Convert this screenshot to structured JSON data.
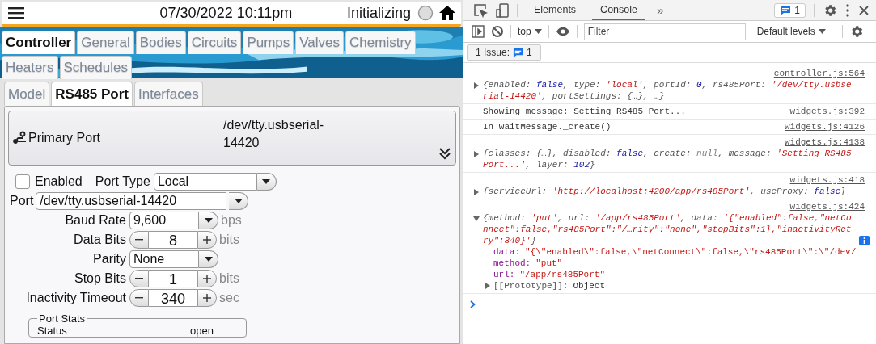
{
  "app": {
    "datetime": "07/30/2022 10:11pm",
    "status": "Initializing",
    "tabs": [
      {
        "label": "Controller",
        "selected": true
      },
      {
        "label": "General",
        "selected": false
      },
      {
        "label": "Bodies",
        "selected": false
      },
      {
        "label": "Circuits",
        "selected": false
      },
      {
        "label": "Pumps",
        "selected": false
      },
      {
        "label": "Valves",
        "selected": false
      },
      {
        "label": "Chemistry",
        "selected": false
      },
      {
        "label": "Heaters",
        "selected": false
      },
      {
        "label": "Schedules",
        "selected": false
      }
    ],
    "subtabs": [
      {
        "label": "Model",
        "selected": false
      },
      {
        "label": "RS485 Port",
        "selected": true
      },
      {
        "label": "Interfaces",
        "selected": false
      }
    ],
    "port_panel": {
      "title": "Primary Port",
      "value": "/dev/tty.usbserial-14420",
      "expanded": false
    },
    "enabled": {
      "label": "Enabled",
      "checked": false
    },
    "port_type": {
      "label": "Port Type",
      "value": "Local"
    },
    "port": {
      "label": "Port",
      "value": "/dev/tty.usbserial-14420"
    },
    "settings": [
      {
        "kind": "select",
        "label": "Baud Rate",
        "value": "9,600",
        "unit": "bps"
      },
      {
        "kind": "stepper",
        "label": "Data Bits",
        "value": "8",
        "unit": "bits"
      },
      {
        "kind": "select",
        "label": "Parity",
        "value": "None"
      },
      {
        "kind": "stepper",
        "label": "Stop Bits",
        "value": "1",
        "unit": "bits"
      },
      {
        "kind": "stepper",
        "label": "Inactivity Timeout",
        "value": "340",
        "unit": "sec"
      }
    ],
    "port_stats": {
      "legend": "Port Stats",
      "rows": [
        {
          "label": "Status",
          "value": "open"
        }
      ]
    }
  },
  "devtools": {
    "tabs": [
      {
        "label": "Elements",
        "selected": false
      },
      {
        "label": "Console",
        "selected": true
      }
    ],
    "more_tabs": "»",
    "issues_badge": "1",
    "context": "top",
    "filter_placeholder": "Filter",
    "levels": "Default levels",
    "issues_label": "1 Issue:",
    "issues_count": "1",
    "entries": [
      {
        "kind": "object",
        "source": "controller.js:564",
        "expanded": false,
        "tokens": [
          {
            "kind": "punct",
            "text": "{enabled: "
          },
          {
            "kind": "keyword",
            "text": "false"
          },
          {
            "kind": "punct",
            "text": ", type: "
          },
          {
            "kind": "string",
            "text": "'local'"
          },
          {
            "kind": "punct",
            "text": ", portId: "
          },
          {
            "kind": "keyword",
            "text": "0"
          },
          {
            "kind": "punct",
            "text": ", rs485Port: "
          },
          {
            "kind": "string",
            "text": "'/dev/tty.usbserial-14420'"
          },
          {
            "kind": "punct",
            "text": ", portSettings: {…}, …}"
          }
        ]
      },
      {
        "kind": "log",
        "source": "widgets.js:392",
        "tokens": [
          {
            "kind": "plain",
            "text": "Showing message: Setting RS485 Port..."
          }
        ]
      },
      {
        "kind": "log",
        "source": "widgets.js:4126",
        "tokens": [
          {
            "kind": "plain",
            "text": "In waitMessage._create()"
          }
        ]
      },
      {
        "kind": "object",
        "source": "widgets.js:4138",
        "expanded": false,
        "tokens": [
          {
            "kind": "punct",
            "text": "{classes: {…}, disabled: "
          },
          {
            "kind": "keyword",
            "text": "false"
          },
          {
            "kind": "punct",
            "text": ", create: "
          },
          {
            "kind": "null",
            "text": "null"
          },
          {
            "kind": "punct",
            "text": ", message: "
          },
          {
            "kind": "string",
            "text": "'Setting RS485 Port...'"
          },
          {
            "kind": "punct",
            "text": ", layer: "
          },
          {
            "kind": "keyword",
            "text": "102"
          },
          {
            "kind": "punct",
            "text": "}"
          }
        ]
      },
      {
        "kind": "object",
        "source": "widgets.js:418",
        "expanded": false,
        "tokens": [
          {
            "kind": "punct",
            "text": "{serviceUrl: "
          },
          {
            "kind": "string",
            "text": "'http://localhost:4200/app/rs485Port'"
          },
          {
            "kind": "punct",
            "text": ", useProxy: "
          },
          {
            "kind": "keyword",
            "text": "false"
          },
          {
            "kind": "punct",
            "text": "}"
          }
        ]
      },
      {
        "kind": "object",
        "source": "widgets.js:424",
        "expanded": true,
        "info": true,
        "tokens": [
          {
            "kind": "punct",
            "text": "{method: "
          },
          {
            "kind": "string",
            "text": "'put'"
          },
          {
            "kind": "punct",
            "text": ", url: "
          },
          {
            "kind": "string",
            "text": "'/app/rs485Port'"
          },
          {
            "kind": "punct",
            "text": ", data: "
          },
          {
            "kind": "string",
            "text": "'{\"enabled\":false,\"netConnect\":false,\"rs485Port\":\"/…rity\":\"none\",\"stopBits\":1},\"inactivityRetry\":340}'"
          },
          {
            "kind": "punct",
            "text": "}"
          }
        ],
        "properties": [
          {
            "kind": "property",
            "key": "data:",
            "value": "\"{\\\"enabled\\\":false,\\\"netConnect\\\":false,\\\"rs485Port\\\":\\\"/dev/"
          },
          {
            "kind": "property",
            "key": "method:",
            "value": "\"put\""
          },
          {
            "kind": "property",
            "key": "url:",
            "value": "\"/app/rs485Port\""
          },
          {
            "kind": "prototype",
            "key": "[[Prototype]]:",
            "value": "Object",
            "expanded": false
          }
        ]
      }
    ]
  }
}
